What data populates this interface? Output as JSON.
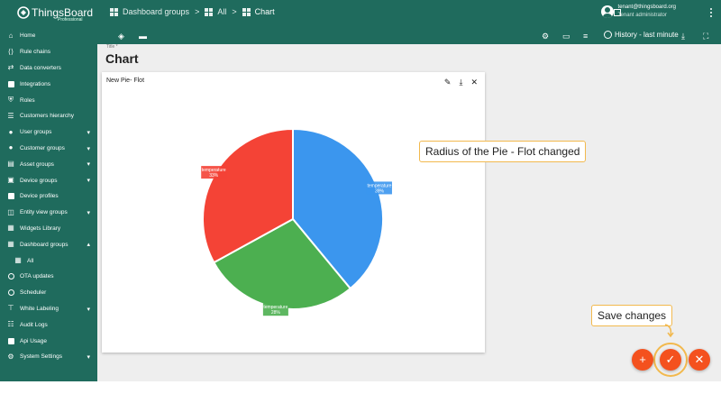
{
  "header": {
    "brand": "ThingsBoard",
    "brand_sub": "Professional",
    "breadcrumbs": [
      "Dashboard groups",
      "All",
      "Chart"
    ],
    "user_email": "tenant@thingsboard.org",
    "user_role": "Tenant administrator"
  },
  "sidebar": {
    "items": [
      {
        "label": "Home",
        "icon": "home-icon"
      },
      {
        "label": "Rule chains",
        "icon": "rule-chains-icon"
      },
      {
        "label": "Data converters",
        "icon": "data-converters-icon"
      },
      {
        "label": "Integrations",
        "icon": "integrations-icon"
      },
      {
        "label": "Roles",
        "icon": "roles-icon"
      },
      {
        "label": "Customers hierarchy",
        "icon": "hierarchy-icon"
      },
      {
        "label": "User groups",
        "icon": "users-icon"
      },
      {
        "label": "Customer groups",
        "icon": "customers-icon"
      },
      {
        "label": "Asset groups",
        "icon": "assets-icon"
      },
      {
        "label": "Device groups",
        "icon": "devices-icon"
      },
      {
        "label": "Device profiles",
        "icon": "device-profiles-icon"
      },
      {
        "label": "Entity view groups",
        "icon": "entity-views-icon"
      },
      {
        "label": "Widgets Library",
        "icon": "widgets-icon"
      },
      {
        "label": "Dashboard groups",
        "icon": "dashboards-icon"
      },
      {
        "label": "All",
        "icon": "grid-icon"
      },
      {
        "label": "OTA updates",
        "icon": "ota-icon"
      },
      {
        "label": "Scheduler",
        "icon": "scheduler-icon"
      },
      {
        "label": "White Labeling",
        "icon": "white-labeling-icon"
      },
      {
        "label": "Audit Logs",
        "icon": "audit-logs-icon"
      },
      {
        "label": "Api Usage",
        "icon": "api-usage-icon"
      },
      {
        "label": "System Settings",
        "icon": "settings-icon"
      }
    ]
  },
  "toolbar": {
    "history_label": "History - last minute"
  },
  "dashboard": {
    "title_hint": "Title *",
    "title": "Chart"
  },
  "widget": {
    "title": "New Pie- Flot",
    "colors": {
      "blue": "#3b96ee",
      "green": "#4caf50",
      "red": "#f44336"
    }
  },
  "chart_data": {
    "type": "pie",
    "series": [
      {
        "name": "temperature",
        "value": 39,
        "label": "39%",
        "color": "#3b96ee"
      },
      {
        "name": "temperature",
        "value": 28,
        "label": "28%",
        "color": "#4caf50"
      },
      {
        "name": "temperature",
        "value": 33,
        "label": "33%",
        "color": "#f44336"
      }
    ]
  },
  "callouts": {
    "radius_changed": "Radius of the Pie - Flot changed",
    "save_changes": "Save changes"
  },
  "fabs": {
    "add": "+",
    "save": "✓",
    "cancel": "✕"
  }
}
